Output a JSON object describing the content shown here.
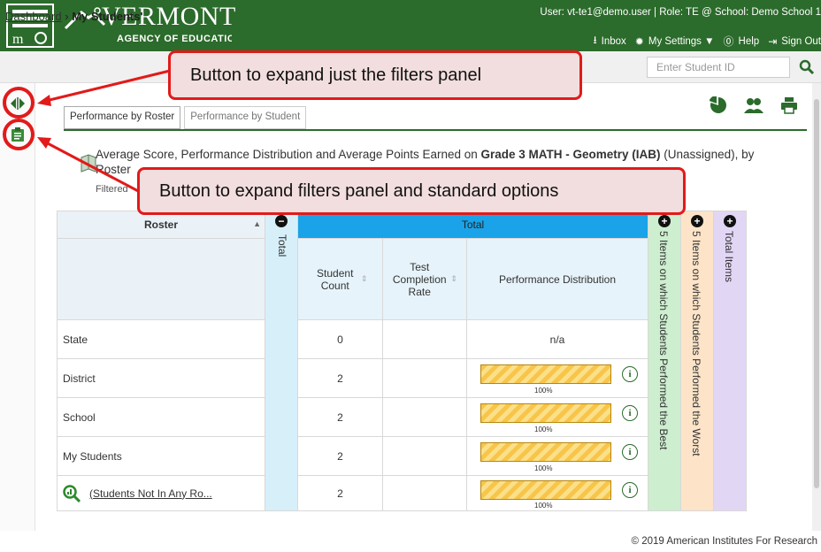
{
  "header": {
    "logo_title": "VERMONT",
    "logo_subtitle": "AGENCY OF EDUCATION",
    "user_line": "User: vt-te1@demo.user  |  Role: TE @ School: Demo School 1",
    "nav": [
      {
        "label": "Inbox",
        "icon": "inbox-icon"
      },
      {
        "label": "My Settings ▼",
        "icon": "gear-icon"
      },
      {
        "label": "Help",
        "icon": "help-icon"
      },
      {
        "label": "Sign Out",
        "icon": "sign-out-icon"
      }
    ]
  },
  "breadcrumb": {
    "home": "Dashboard",
    "separator": ">",
    "current": "My Students'"
  },
  "search": {
    "placeholder": "Enter Student ID"
  },
  "tabs": [
    {
      "label": "Performance by Roster",
      "active": true
    },
    {
      "label": "Performance by Student",
      "active": false
    }
  ],
  "description": {
    "prefix": "Average Score, Performance Distribution and Average Points Earned on ",
    "assessment": "Grade 3 MATH - Geometry (IAB)",
    "suffix": " (Unassigned), by",
    "line2": "Roster",
    "filtered": "Filtered"
  },
  "table": {
    "headers": {
      "roster": "Roster",
      "total_vertical": "Total",
      "total": "Total",
      "student_count": "Student Count",
      "completion": "Test Completion Rate",
      "perf_dist": "Performance Distribution",
      "best": "5 Items on which Students Performed the Best",
      "worst": "5 Items on which Students Performed the Worst",
      "total_items": "Total Items"
    },
    "rows": [
      {
        "name": "State",
        "count": "0",
        "dist": "n/a",
        "pct": "",
        "link": false
      },
      {
        "name": "District",
        "count": "2",
        "dist": "",
        "pct": "100%",
        "link": false
      },
      {
        "name": "School",
        "count": "2",
        "dist": "",
        "pct": "100%",
        "link": false
      },
      {
        "name": "My Students",
        "count": "2",
        "dist": "",
        "pct": "100%",
        "link": false
      },
      {
        "name": "(Students Not In Any Ro...",
        "count": "2",
        "dist": "",
        "pct": "100%",
        "link": true
      }
    ]
  },
  "callouts": {
    "filters_only": "Button to expand just the filters panel",
    "filters_and_options": "Button to expand filters panel and standard options"
  },
  "footer": "© 2019 American Institutes For Research",
  "colors": {
    "header": "#2b6b2b",
    "total_header": "#1aa3e8",
    "best_col": "#cdeecf",
    "worst_col": "#fde4c8",
    "total_items_col": "#e2d6f5",
    "callout_border": "#e21a1a",
    "bar": "#f8c54a"
  }
}
